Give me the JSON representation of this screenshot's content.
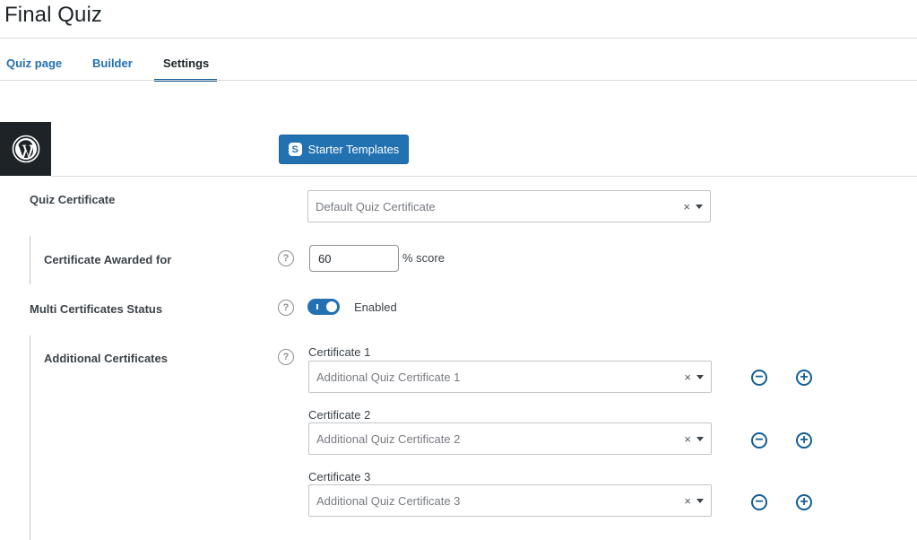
{
  "page": {
    "title": "Final Quiz"
  },
  "tabs": [
    {
      "label": "Quiz page"
    },
    {
      "label": "Builder"
    },
    {
      "label": "Settings"
    }
  ],
  "toolbar": {
    "starter_templates_label": "Starter Templates",
    "starter_icon_glyph": "S"
  },
  "settings": {
    "quiz_certificate": {
      "label": "Quiz Certificate",
      "placeholder": "Default Quiz Certificate"
    },
    "certificate_awarded_for": {
      "label": "Certificate Awarded for",
      "value": "60",
      "suffix": "% score"
    },
    "multi_certificates_status": {
      "label": "Multi Certificates Status",
      "toggle_state": "Enabled"
    },
    "additional_certificates": {
      "label": "Additional Certificates",
      "items": [
        {
          "label": "Certificate 1",
          "placeholder": "Additional Quiz Certificate 1"
        },
        {
          "label": "Certificate 2",
          "placeholder": "Additional Quiz Certificate 2"
        },
        {
          "label": "Certificate 3",
          "placeholder": "Additional Quiz Certificate 3"
        }
      ]
    }
  },
  "glyphs": {
    "help": "?",
    "clear": "×",
    "minus": "−",
    "plus": "+"
  },
  "icons": {
    "wordpress": "wordpress-logo-icon",
    "help": "help-icon",
    "remove": "minus-circle-icon",
    "add": "plus-circle-icon"
  },
  "colors": {
    "accent": "#2271b1",
    "text": "#1d2327",
    "border": "#dcdcde",
    "wp_box": "#1d2327"
  }
}
